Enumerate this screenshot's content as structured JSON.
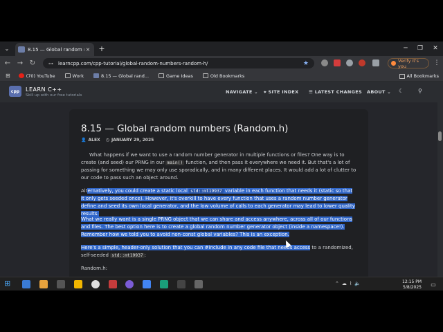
{
  "browser": {
    "tab_title": "8.15 — Global random numbe",
    "tab_close": "×",
    "new_tab": "+",
    "url": "learncpp.com/cpp-tutorial/global-random-numbers-random-h/",
    "verify_label": "Verify it's you",
    "bookmarks": [
      {
        "label": "(70) YouTube",
        "color": "#e62117"
      },
      {
        "label": "Work",
        "color": "#9aa0a6"
      },
      {
        "label": "8.15 — Global rand...",
        "color": "#6d7ea8"
      },
      {
        "label": "Game Ideas",
        "color": "#9aa0a6"
      },
      {
        "label": "Old Bookmarks",
        "color": "#9aa0a6"
      }
    ],
    "all_bookmarks": "All Bookmarks"
  },
  "site": {
    "logo_text": "cpp",
    "brand_name": "LEARN C++",
    "brand_tagline": "Skill up with our free tutorials",
    "nav": [
      {
        "label": "NAVIGATE ⌄"
      },
      {
        "label": "⌖ SITE INDEX"
      },
      {
        "label": "☰ LATEST CHANGES"
      },
      {
        "label": "ABOUT ⌄"
      }
    ]
  },
  "article": {
    "title": "8.15 — Global random numbers (Random.h)",
    "author": "ALEX",
    "date": "JANUARY 29, 2025",
    "p1_a": "What happens if we want to use a random number generator in multiple functions or files? One way is to create (and seed) our PRNG in our ",
    "p1_code": "main()",
    "p1_b": " function, and then pass it everywhere we need it. But that's a lot of passing for something we may only use sporadically, and in many different places. It would add a lot of clutter to our code to pass such an object around.",
    "p2_pre": "Alt",
    "p2_a": "ernatively, you could create a static local ",
    "p2_code": "std::mt19937",
    "p2_b": " variable in each function that needs it (static so that it only gets seeded once). However, it's overkill to have every function that uses a random number generator define and seed its own local generator, and the low volume of calls to each generator may lead to lower quality results.",
    "p3": "What we really want is a single PRNG object that we can share and access anywhere, across all of our functions and files. The best option here is to create a global random number generator object (inside a namespace!). Remember how we told you to avoid non-const global variables? This is an exception.",
    "p4_sel": "Here's a simple, header-only solution that you can #include in any code file that needs access",
    "p4_rest": " to a randomized, self-seeded ",
    "p4_code": "std::mt19937",
    "p4_end": ":",
    "p5": "Random.h:"
  },
  "taskbar": {
    "time": "12:15 PM",
    "date": "5/8/2025",
    "apps": [
      {
        "color": "#3a7bd5"
      },
      {
        "color": "#e8a33d"
      },
      {
        "color": "#555"
      },
      {
        "color": "#f2b600"
      },
      {
        "color": "#e0e0e0"
      },
      {
        "color": "#c73c3c"
      },
      {
        "color": "#7b5cd6"
      },
      {
        "color": "#4285f4"
      },
      {
        "color": "#1a9e7a"
      },
      {
        "color": "#444"
      },
      {
        "color": "#666"
      },
      {
        "color": "#2eaa4f"
      }
    ]
  }
}
